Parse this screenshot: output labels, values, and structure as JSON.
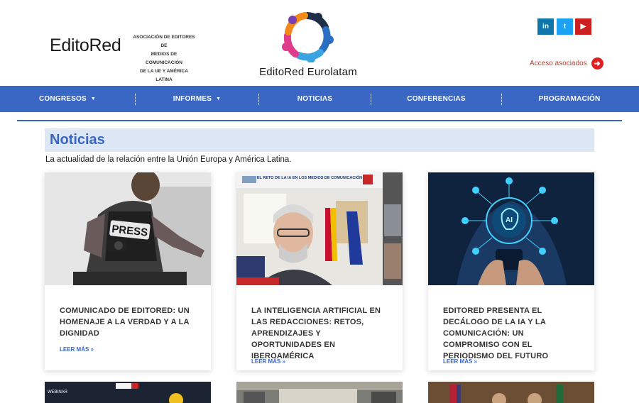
{
  "header": {
    "brand": "EditoRed",
    "association_lines": [
      "ASOCIACIÓN DE EDITORES DE",
      "MEDIOS DE COMUNICACIÓN",
      "DE LA UE Y AMÉRICA LATINA"
    ],
    "logo_text": "EditoRed Eurolatam",
    "social": [
      "in",
      "t",
      "▶"
    ],
    "acceso_label": "Acceso asociados"
  },
  "nav": {
    "items": [
      {
        "label": "CONGRESOS",
        "dropdown": true
      },
      {
        "label": "INFORMES",
        "dropdown": true
      },
      {
        "label": "NOTICIAS",
        "dropdown": false
      },
      {
        "label": "CONFERENCIAS",
        "dropdown": false
      },
      {
        "label": "PROGRAMACIÓN",
        "dropdown": false
      }
    ]
  },
  "main": {
    "title": "Noticias",
    "subtitle": "La actualidad de la relación entre la Unión Europa y América Latina.",
    "cards": [
      {
        "title": "COMUNICADO DE EDITORED: UN HOMENAJE A LA VERDAD Y A LA DIGNIDAD",
        "more": "LEER MÁS »",
        "image_text": "PRESS"
      },
      {
        "title": "LA INTELIGENCIA ARTIFICIAL EN LAS REDACCIONES: RETOS, APRENDIZAJES Y OPORTUNIDADES EN IBEROAMÉRICA",
        "more": "LEER MÁS »",
        "image_text": "EL RETO DE LA IA EN LOS MEDIOS DE COMUNICACIÓN"
      },
      {
        "title": "EDITORED PRESENTA EL DECÁLOGO DE LA IA Y LA COMUNICACIÓN: UN COMPROMISO CON EL PERIODISMO DEL FUTURO",
        "more": "LEER MÁS »",
        "image_text": "AI"
      }
    ],
    "second_row_text": "WEBINAR"
  },
  "colors": {
    "nav_blue": "#3a67c4",
    "heading_bg": "#dce6f5",
    "accent_red": "#e02020"
  }
}
